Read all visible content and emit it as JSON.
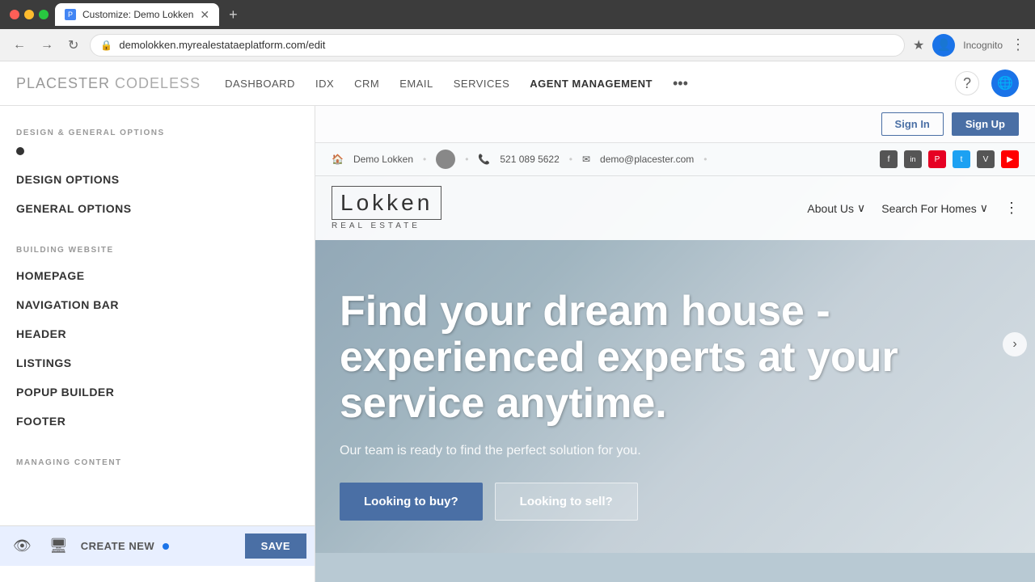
{
  "browser": {
    "dots": [
      "red",
      "yellow",
      "green"
    ],
    "tab_title": "Customize: Demo Lokken",
    "url": "demolokken.myrealestataeplatform.com/edit",
    "new_tab_icon": "+",
    "back_btn": "←",
    "forward_btn": "→",
    "refresh_btn": "↻",
    "star_label": "★",
    "incognito_label": "Incognito",
    "more_label": "⋮"
  },
  "app_header": {
    "logo_main": "PLACESTER",
    "logo_sub": " CODELESS",
    "nav_items": [
      {
        "label": "DASHBOARD",
        "active": false
      },
      {
        "label": "IDX",
        "active": false
      },
      {
        "label": "CRM",
        "active": false
      },
      {
        "label": "EMAIL",
        "active": false
      },
      {
        "label": "SERVICES",
        "active": false
      },
      {
        "label": "AGENT MANAGEMENT",
        "active": true
      }
    ],
    "more_label": "•••",
    "help_label": "?",
    "profile_label": "👤"
  },
  "sidebar": {
    "section1_title": "DESIGN & GENERAL OPTIONS",
    "design_options_label": "DESIGN OPTIONS",
    "general_options_label": "GENERAL OPTIONS",
    "section2_title": "BUILDING WEBSITE",
    "building_items": [
      {
        "label": "HOMEPAGE"
      },
      {
        "label": "NAVIGATION BAR"
      },
      {
        "label": "HEADER"
      },
      {
        "label": "LISTINGS"
      },
      {
        "label": "POPUP BUILDER"
      },
      {
        "label": "FOOTER"
      }
    ],
    "section3_title": "MANAGING CONTENT",
    "footer": {
      "eye_icon": "👁",
      "desktop_icon": "🖥",
      "create_new_label": "CREATE NEW",
      "save_label": "SAVE"
    }
  },
  "site_preview": {
    "sign_in_label": "Sign In",
    "sign_up_label": "Sign Up",
    "contact_name": "Demo Lokken",
    "contact_phone": "521 089 5622",
    "contact_email": "demo@placester.com",
    "social_icons": [
      "f",
      "in",
      "P",
      "t",
      "V",
      "▶"
    ],
    "logo_name": "Lokken",
    "logo_sub": "REAL ESTATE",
    "nav_about": "About Us",
    "nav_about_arrow": "∨",
    "nav_search": "Search For Homes",
    "nav_search_arrow": "∨",
    "nav_dots": "⋮",
    "hero_title": "Find your dream house - experienced experts at your service anytime.",
    "hero_subtitle": "Our team is ready to find the perfect solution for you.",
    "btn_buy": "Looking to buy?",
    "btn_sell": "Looking to sell?"
  }
}
